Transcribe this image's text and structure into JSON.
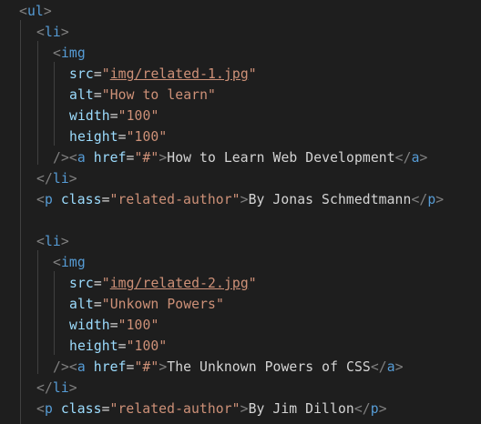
{
  "colors": {
    "background": "#1e1e1e",
    "tag": "#569cd6",
    "attribute": "#9cdcfe",
    "string": "#ce9178",
    "text": "#d4d4d4",
    "punctuation": "#808080",
    "indent_guide": "#404040"
  },
  "lines": [
    [
      {
        "t": "<",
        "c": "punct"
      },
      {
        "t": "ul",
        "c": "tag"
      },
      {
        "t": ">",
        "c": "punct"
      }
    ],
    [
      {
        "t": "<",
        "c": "punct"
      },
      {
        "t": "li",
        "c": "tag"
      },
      {
        "t": ">",
        "c": "punct"
      }
    ],
    [
      {
        "t": "<",
        "c": "punct"
      },
      {
        "t": "img",
        "c": "tag"
      }
    ],
    [
      {
        "t": "src",
        "c": "attr"
      },
      {
        "t": "=",
        "c": "eq"
      },
      {
        "t": "\"",
        "c": "str"
      },
      {
        "t": "img/related-1.jpg",
        "c": "str",
        "link": true
      },
      {
        "t": "\"",
        "c": "str"
      }
    ],
    [
      {
        "t": "alt",
        "c": "attr"
      },
      {
        "t": "=",
        "c": "eq"
      },
      {
        "t": "\"How to learn\"",
        "c": "str"
      }
    ],
    [
      {
        "t": "width",
        "c": "attr"
      },
      {
        "t": "=",
        "c": "eq"
      },
      {
        "t": "\"100\"",
        "c": "str"
      }
    ],
    [
      {
        "t": "height",
        "c": "attr"
      },
      {
        "t": "=",
        "c": "eq"
      },
      {
        "t": "\"100\"",
        "c": "str"
      }
    ],
    [
      {
        "t": "/>",
        "c": "punct"
      },
      {
        "t": "<",
        "c": "punct"
      },
      {
        "t": "a",
        "c": "tag"
      },
      {
        "t": " ",
        "c": "text"
      },
      {
        "t": "href",
        "c": "attr"
      },
      {
        "t": "=",
        "c": "eq"
      },
      {
        "t": "\"#\"",
        "c": "str"
      },
      {
        "t": ">",
        "c": "punct"
      },
      {
        "t": "How to Learn Web Development",
        "c": "text"
      },
      {
        "t": "</",
        "c": "punct"
      },
      {
        "t": "a",
        "c": "tag"
      },
      {
        "t": ">",
        "c": "punct"
      }
    ],
    [
      {
        "t": "</",
        "c": "punct"
      },
      {
        "t": "li",
        "c": "tag"
      },
      {
        "t": ">",
        "c": "punct"
      }
    ],
    [
      {
        "t": "<",
        "c": "punct"
      },
      {
        "t": "p",
        "c": "tag"
      },
      {
        "t": " ",
        "c": "text"
      },
      {
        "t": "class",
        "c": "attr"
      },
      {
        "t": "=",
        "c": "eq"
      },
      {
        "t": "\"related-author\"",
        "c": "str"
      },
      {
        "t": ">",
        "c": "punct"
      },
      {
        "t": "By Jonas Schmedtmann",
        "c": "text"
      },
      {
        "t": "</",
        "c": "punct"
      },
      {
        "t": "p",
        "c": "tag"
      },
      {
        "t": ">",
        "c": "punct"
      }
    ],
    [],
    [
      {
        "t": "<",
        "c": "punct"
      },
      {
        "t": "li",
        "c": "tag"
      },
      {
        "t": ">",
        "c": "punct"
      }
    ],
    [
      {
        "t": "<",
        "c": "punct"
      },
      {
        "t": "img",
        "c": "tag"
      }
    ],
    [
      {
        "t": "src",
        "c": "attr"
      },
      {
        "t": "=",
        "c": "eq"
      },
      {
        "t": "\"",
        "c": "str"
      },
      {
        "t": "img/related-2.jpg",
        "c": "str",
        "link": true
      },
      {
        "t": "\"",
        "c": "str"
      }
    ],
    [
      {
        "t": "alt",
        "c": "attr"
      },
      {
        "t": "=",
        "c": "eq"
      },
      {
        "t": "\"Unkown Powers\"",
        "c": "str"
      }
    ],
    [
      {
        "t": "width",
        "c": "attr"
      },
      {
        "t": "=",
        "c": "eq"
      },
      {
        "t": "\"100\"",
        "c": "str"
      }
    ],
    [
      {
        "t": "height",
        "c": "attr"
      },
      {
        "t": "=",
        "c": "eq"
      },
      {
        "t": "\"100\"",
        "c": "str"
      }
    ],
    [
      {
        "t": "/>",
        "c": "punct"
      },
      {
        "t": "<",
        "c": "punct"
      },
      {
        "t": "a",
        "c": "tag"
      },
      {
        "t": " ",
        "c": "text"
      },
      {
        "t": "href",
        "c": "attr"
      },
      {
        "t": "=",
        "c": "eq"
      },
      {
        "t": "\"#\"",
        "c": "str"
      },
      {
        "t": ">",
        "c": "punct"
      },
      {
        "t": "The Unknown Powers of CSS",
        "c": "text"
      },
      {
        "t": "</",
        "c": "punct"
      },
      {
        "t": "a",
        "c": "tag"
      },
      {
        "t": ">",
        "c": "punct"
      }
    ],
    [
      {
        "t": "</",
        "c": "punct"
      },
      {
        "t": "li",
        "c": "tag"
      },
      {
        "t": ">",
        "c": "punct"
      }
    ],
    [
      {
        "t": "<",
        "c": "punct"
      },
      {
        "t": "p",
        "c": "tag"
      },
      {
        "t": " ",
        "c": "text"
      },
      {
        "t": "class",
        "c": "attr"
      },
      {
        "t": "=",
        "c": "eq"
      },
      {
        "t": "\"related-author\"",
        "c": "str"
      },
      {
        "t": ">",
        "c": "punct"
      },
      {
        "t": "By Jim Dillon",
        "c": "text"
      },
      {
        "t": "</",
        "c": "punct"
      },
      {
        "t": "p",
        "c": "tag"
      },
      {
        "t": ">",
        "c": "punct"
      }
    ]
  ]
}
